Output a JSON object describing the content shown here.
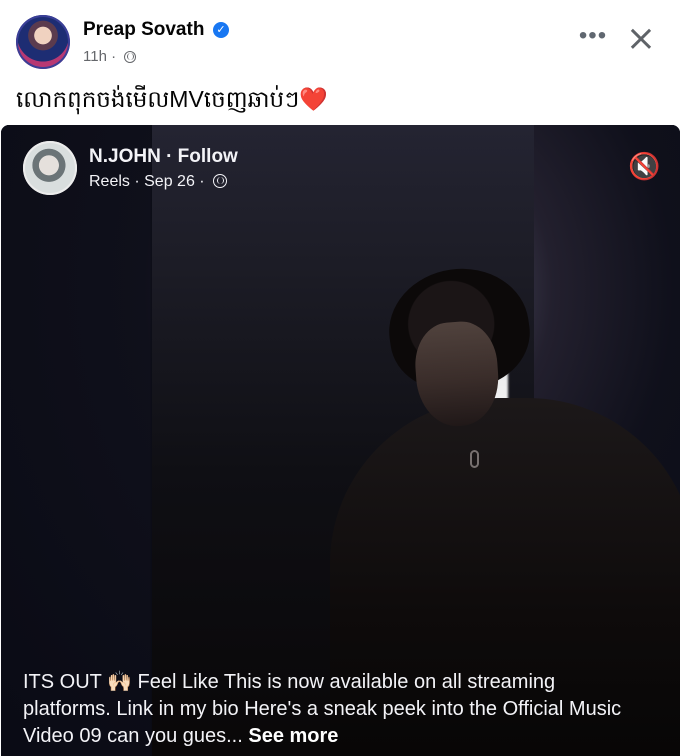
{
  "post": {
    "author": "Preap Sovath",
    "time": "11h",
    "separator": "·",
    "caption": "លោកពុកចង់មើលMVចេញឆាប់ៗ❤️",
    "more_icon": "more-icon",
    "close_icon": "close-icon"
  },
  "reel": {
    "author": "N.JOHN · Follow",
    "meta": "Reels · Sep 26 ·",
    "mute_icon": "mute-icon",
    "description_before": "ITS OUT 🙌🏻 Feel Like This is now available on all streaming platforms. Link in my bio Here's a sneak peek into the Official Music Video 09 can you gues... ",
    "see_more": "See more"
  },
  "colors": {
    "accent": "#1877f2",
    "secondary_text": "#65676b",
    "reel_background": "#11131f"
  }
}
